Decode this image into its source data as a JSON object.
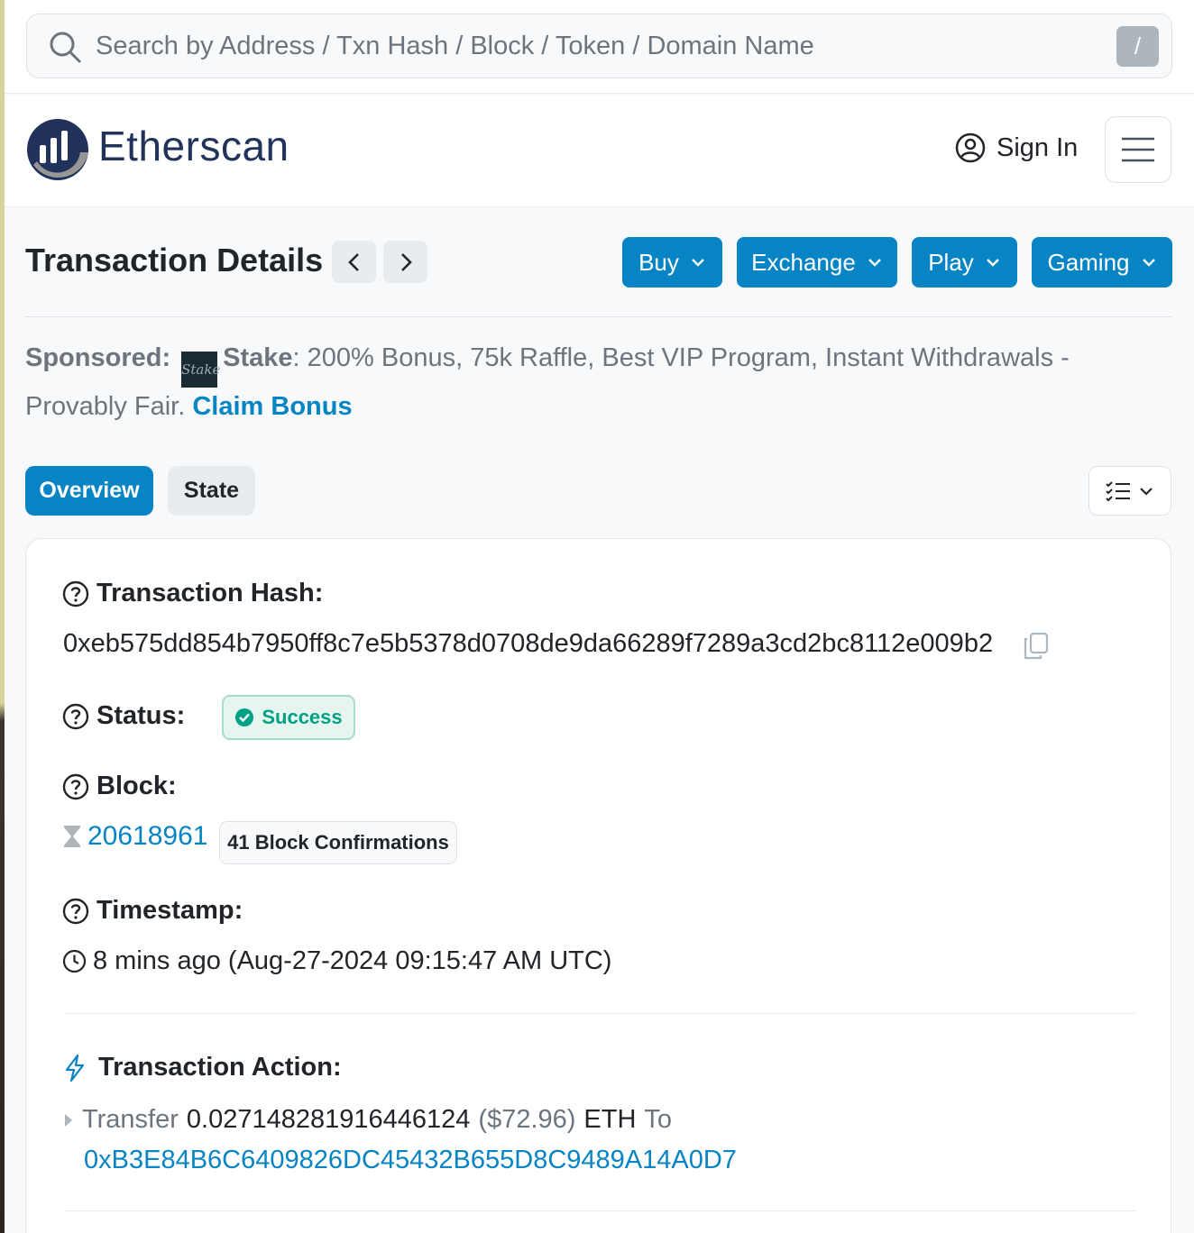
{
  "search": {
    "placeholder": "Search by Address / Txn Hash / Block / Token / Domain Name",
    "shortcut": "/"
  },
  "header": {
    "brand": "Etherscan",
    "signin_label": "Sign In"
  },
  "page": {
    "title": "Transaction Details",
    "categories": [
      "Buy",
      "Exchange",
      "Play",
      "Gaming"
    ]
  },
  "sponsored": {
    "label": "Sponsored:",
    "brand": "Stake",
    "text": ": 200% Bonus, 75k Raffle, Best VIP Program, Instant Withdrawals - Provably Fair.",
    "cta": "Claim Bonus"
  },
  "tabs": [
    "Overview",
    "State"
  ],
  "details": {
    "hash_label": "Transaction Hash:",
    "hash": "0xeb575dd854b7950ff8c7e5b5378d0708de9da66289f7289a3cd2bc8112e009b2",
    "status_label": "Status:",
    "status": "Success",
    "block_label": "Block:",
    "block": "20618961",
    "confirmations": "41 Block Confirmations",
    "timestamp_label": "Timestamp:",
    "timestamp": "8 mins ago (Aug-27-2024 09:15:47 AM UTC)",
    "action_label": "Transaction Action:",
    "action": {
      "verb": "Transfer",
      "amount": "0.027148281916446124",
      "usd": "($72.96)",
      "unit": "ETH",
      "to_label": "To",
      "to_address": "0xB3E84B6C6409826DC45432B655D8C9489A14A0D7"
    }
  },
  "colors": {
    "primary": "#0784c3",
    "success": "#00a186",
    "brand_navy": "#21325b"
  }
}
